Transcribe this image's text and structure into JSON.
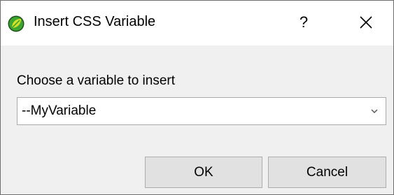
{
  "window": {
    "title": "Insert CSS Variable",
    "help_label": "?"
  },
  "icons": {
    "app": "leaf-icon",
    "close": "close-icon",
    "dropdown": "chevron-down-icon"
  },
  "form": {
    "prompt": "Choose a variable to insert",
    "selected_variable": "--MyVariable"
  },
  "buttons": {
    "ok_label": "OK",
    "cancel_label": "Cancel"
  },
  "colors": {
    "leaf_green": "#3ca72f",
    "leaf_dark": "#1d4d1a",
    "leaf_yellow": "#d6e02b",
    "dialog_bg": "#f0f0f0",
    "button_bg": "#e1e1e1"
  }
}
